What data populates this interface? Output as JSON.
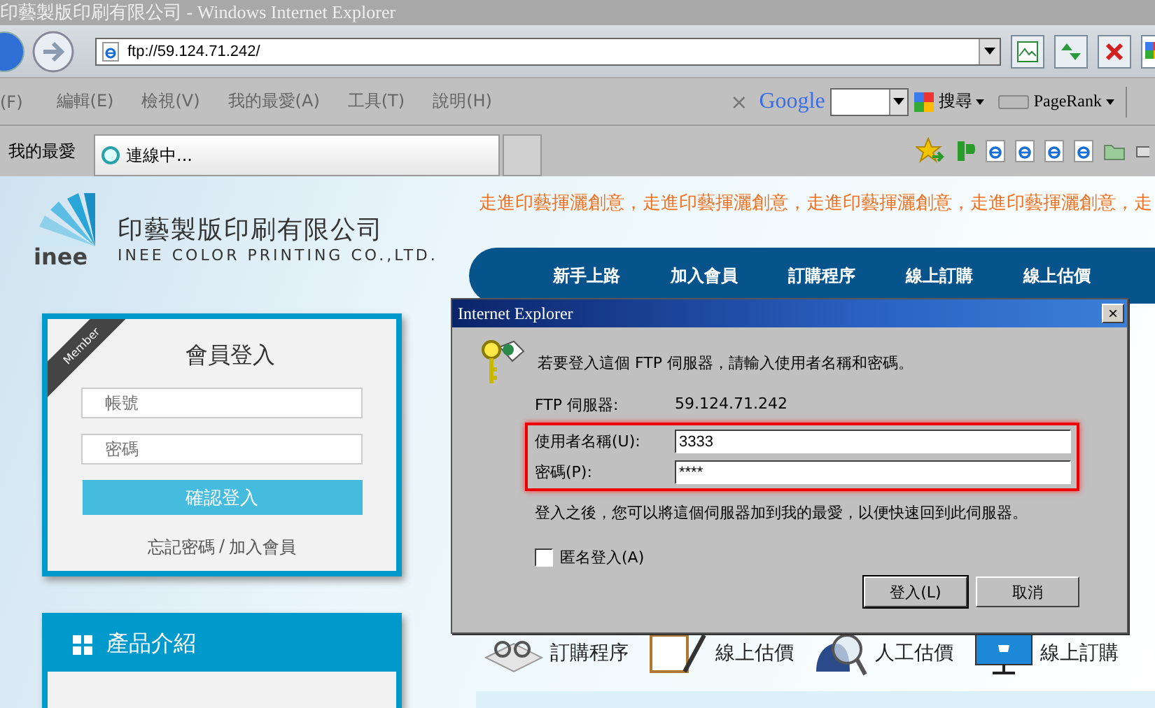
{
  "window": {
    "title": "印藝製版印刷有限公司 - Windows Internet Explorer"
  },
  "address_bar": {
    "url": "ftp://59.124.71.242/"
  },
  "menu_bar": {
    "items": [
      "(F)",
      "編輯(E)",
      "檢視(V)",
      "我的最愛(A)",
      "工具(T)",
      "說明(H)"
    ]
  },
  "google_toolbar": {
    "close": "×",
    "logo": "Google",
    "search_button": "搜尋",
    "pagerank": "PageRank"
  },
  "favorites_bar": {
    "label": "我的最愛",
    "tabs": [
      {
        "label": "連線中...",
        "selected": true
      }
    ]
  },
  "page": {
    "logo": {
      "mark": "inee",
      "name": "印藝製版印刷有限公司",
      "english": "INEE COLOR PRINTING CO.,LTD."
    },
    "tagline": "走進印藝揮灑創意，走進印藝揮灑創意，走進印藝揮灑創意，走進印藝揮灑創意，走",
    "nav": [
      "新手上路",
      "加入會員",
      "訂購程序",
      "線上訂購",
      "線上估價"
    ],
    "login": {
      "ribbon": "Member",
      "title": "會員登入",
      "fields": [
        {
          "placeholder": "帳號"
        },
        {
          "placeholder": "密碼"
        }
      ],
      "submit": "確認登入",
      "links": [
        "忘記密碼",
        "加入會員"
      ],
      "separator": "/"
    },
    "products": {
      "title": "產品介紹"
    },
    "services": [
      {
        "kind": "glasses",
        "label": "訂購程序"
      },
      {
        "kind": "clipboard",
        "label": "線上估價"
      },
      {
        "kind": "magnifier",
        "label": "人工估價"
      },
      {
        "kind": "monitor",
        "label": "線上訂購"
      }
    ]
  },
  "dialog": {
    "title": "Internet Explorer",
    "close": "×",
    "message": "若要登入這個 FTP 伺服器，請輸入使用者名稱和密碼。",
    "server_label": "FTP 伺服器:",
    "server": "59.124.71.242",
    "fields": [
      {
        "label": "使用者名稱(U):",
        "value": "3333"
      },
      {
        "label": "密碼(P):",
        "value": "****"
      }
    ],
    "note": "登入之後，您可以將這個伺服器加到我的最愛，以便快速回到此伺服器。",
    "anonymous": {
      "label": "匿名登入(A)",
      "checked": false
    },
    "buttons": [
      "登入(L)",
      "取消"
    ]
  }
}
